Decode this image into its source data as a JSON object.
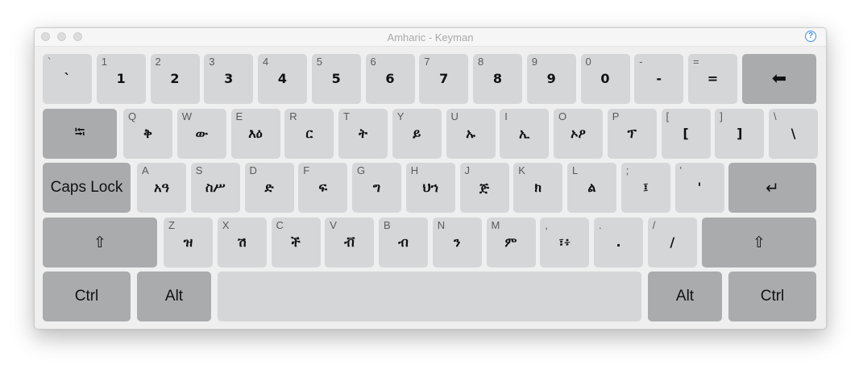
{
  "window": {
    "title": "Amharic - Keyman",
    "help_label": "?"
  },
  "rows": [
    [
      {
        "shift": "`",
        "base": "`"
      },
      {
        "shift": "1",
        "base": "1"
      },
      {
        "shift": "2",
        "base": "2"
      },
      {
        "shift": "3",
        "base": "3"
      },
      {
        "shift": "4",
        "base": "4"
      },
      {
        "shift": "5",
        "base": "5"
      },
      {
        "shift": "6",
        "base": "6"
      },
      {
        "shift": "7",
        "base": "7"
      },
      {
        "shift": "8",
        "base": "8"
      },
      {
        "shift": "9",
        "base": "9"
      },
      {
        "shift": "0",
        "base": "0"
      },
      {
        "shift": "-",
        "base": "-"
      },
      {
        "shift": "=",
        "base": "="
      }
    ],
    [
      {
        "shift": "Q",
        "base": "ቅ"
      },
      {
        "shift": "W",
        "base": "ው"
      },
      {
        "shift": "E",
        "base": "እዕ"
      },
      {
        "shift": "R",
        "base": "ር"
      },
      {
        "shift": "T",
        "base": "ት"
      },
      {
        "shift": "Y",
        "base": "ይ"
      },
      {
        "shift": "U",
        "base": "ኡ"
      },
      {
        "shift": "I",
        "base": "ኢ"
      },
      {
        "shift": "O",
        "base": "ኦዖ"
      },
      {
        "shift": "P",
        "base": "ፕ"
      },
      {
        "shift": "[",
        "base": "["
      },
      {
        "shift": "]",
        "base": "]"
      },
      {
        "shift": "\\",
        "base": "\\"
      }
    ],
    [
      {
        "shift": "A",
        "base": "አዓ"
      },
      {
        "shift": "S",
        "base": "ስሥ"
      },
      {
        "shift": "D",
        "base": "ድ"
      },
      {
        "shift": "F",
        "base": "ፍ"
      },
      {
        "shift": "G",
        "base": "ግ"
      },
      {
        "shift": "H",
        "base": "ህኀ"
      },
      {
        "shift": "J",
        "base": "ጅ"
      },
      {
        "shift": "K",
        "base": "ክ"
      },
      {
        "shift": "L",
        "base": "ል"
      },
      {
        "shift": ";",
        "base": "፤"
      },
      {
        "shift": "'",
        "base": "'"
      }
    ],
    [
      {
        "shift": "Z",
        "base": "ዝ"
      },
      {
        "shift": "X",
        "base": "ሽ"
      },
      {
        "shift": "C",
        "base": "ች"
      },
      {
        "shift": "V",
        "base": "ቭ"
      },
      {
        "shift": "B",
        "base": "ብ"
      },
      {
        "shift": "N",
        "base": "ን"
      },
      {
        "shift": "M",
        "base": "ም"
      },
      {
        "shift": ",",
        "base": "፣፥"
      },
      {
        "shift": ".",
        "base": "."
      },
      {
        "shift": "/",
        "base": "/"
      }
    ]
  ],
  "special": {
    "backspace_icon": "backspace-icon",
    "tab_icon": "tab-icon",
    "caps_lock": "Caps Lock",
    "enter_icon": "enter-icon",
    "shift_icon": "shift-icon",
    "ctrl": "Ctrl",
    "alt": "Alt"
  },
  "colors": {
    "key": "#d5d6d7",
    "special_key": "#a9abad"
  }
}
